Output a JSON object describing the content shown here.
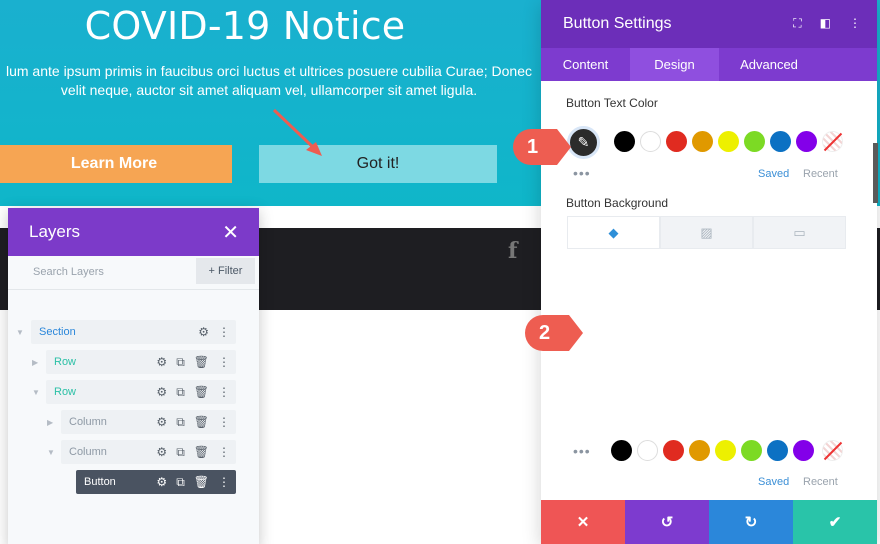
{
  "hero": {
    "title": "COVID-19 Notice",
    "text_line1": "lum ante ipsum primis in faucibus orci luctus et ultrices posuere cubilia Curae; Donec",
    "text_line2": "velit neque, auctor sit amet aliquam vel, ullamcorper sit amet ligula.",
    "learn_more": "Learn More",
    "got_it": "Got it!"
  },
  "layers": {
    "title": "Layers",
    "search_placeholder": "Search Layers",
    "filter_label": "+ Filter",
    "items": [
      {
        "label": "Section"
      },
      {
        "label": "Row"
      },
      {
        "label": "Row"
      },
      {
        "label": "Column"
      },
      {
        "label": "Column"
      },
      {
        "label": "Button"
      }
    ]
  },
  "modal": {
    "title": "Button Settings",
    "tabs": [
      "Content",
      "Design",
      "Advanced"
    ],
    "active_tab": "Design",
    "text_color_label": "Button Text Color",
    "background_label": "Button Background",
    "saved": "Saved",
    "recent": "Recent",
    "swatches": [
      "#000000",
      "#ffffff",
      "#e02b20",
      "#e09900",
      "#edf000",
      "#7cda24",
      "#0c71c3",
      "#8300e9"
    ]
  },
  "badges": {
    "one": "1",
    "two": "2"
  },
  "colors": {
    "header_purple": "#6c2eb9",
    "tab_purple": "#7d3bcf",
    "hero_teal": "#1ab0cf",
    "learn_more_orange": "#f6a553",
    "footer": [
      "#ef5555",
      "#7d3bcf",
      "#2b87da",
      "#29c4a9"
    ]
  },
  "icons": [
    "eyedropper-icon",
    "paint-bucket-icon",
    "gradient-icon",
    "image-icon",
    "close-icon",
    "undo-icon",
    "redo-icon",
    "check-icon",
    "gear-icon",
    "duplicate-icon",
    "trash-icon",
    "more-icon",
    "facebook-icon"
  ]
}
